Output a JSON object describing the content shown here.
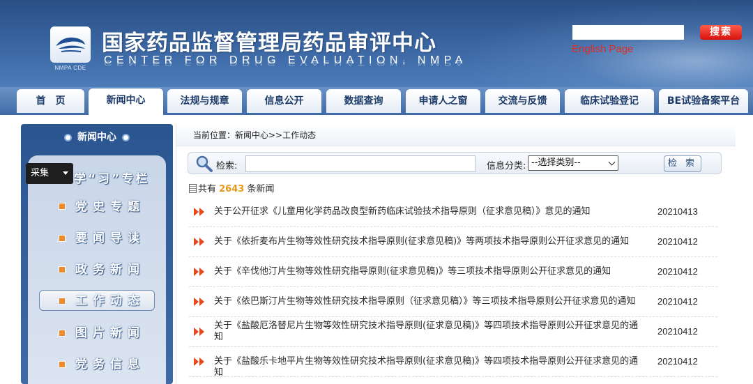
{
  "header": {
    "title_cn": "国家药品监督管理局药品审评中心",
    "title_en": "CENTER FOR DRUG EVALUATION, NMPA",
    "logo_caption": "NMPA CDE",
    "search_button": "搜索",
    "english_link": "English Page"
  },
  "nav": {
    "tabs": [
      {
        "label": "首　页"
      },
      {
        "label": "新闻中心",
        "active": true
      },
      {
        "label": "法规与规章"
      },
      {
        "label": "信息公开"
      },
      {
        "label": "数据查询"
      },
      {
        "label": "申请人之窗"
      },
      {
        "label": "交流与反馈"
      },
      {
        "label": "临床试验登记"
      },
      {
        "label": "BE试验备案平台"
      }
    ]
  },
  "sidebar": {
    "heading": "新闻中心",
    "collect_label": "采集",
    "items": [
      {
        "label": "学“习”专栏"
      },
      {
        "label": "党史专题"
      },
      {
        "label": "要闻导读"
      },
      {
        "label": "政务新闻"
      },
      {
        "label": "工作动态",
        "active": true
      },
      {
        "label": "图片新闻"
      },
      {
        "label": "党务信息"
      }
    ]
  },
  "breadcrumb": {
    "text": "当前位置：新闻中心>>工作动态"
  },
  "search": {
    "label": "检索:",
    "value": "",
    "category_label": "信息分类:",
    "category_selected": "--选择类别--",
    "button": "检 索"
  },
  "count": {
    "prefix": "共有 ",
    "value": "2643",
    "suffix": " 条新闻"
  },
  "colors": {
    "accent": "#e89818",
    "header_blue": "#2a4f86",
    "arrow_red": "#e8281e"
  },
  "news": [
    {
      "title": "关于公开征求《儿童用化学药品改良型新药临床试验技术指导原则（征求意见稿）》意见的通知",
      "date": "20210413"
    },
    {
      "title": "关于《依折麦布片生物等效性研究技术指导原则(征求意见稿)》等两项技术指导原则公开征求意见的通知",
      "date": "20210412"
    },
    {
      "title": "关于《辛伐他汀片生物等效性研究指导原则(征求意见稿)》等三项技术指导原则公开征求意见的通知",
      "date": "20210412"
    },
    {
      "title": "关于《依巴斯汀片生物等效性研究技术指导原则（征求意见稿）》等三项技术指导原则公开征求意见的通知",
      "date": "20210412"
    },
    {
      "title": "关于《盐酸厄洛替尼片生物等效性研究技术指导原则(征求意见稿)》等四项技术指导原则公开征求意见的通知",
      "date": "20210412"
    },
    {
      "title": "关于《盐酸乐卡地平片生物等效性研究技术指导原则(征求意见稿)》等四项技术指导原则公开征求意见的通知",
      "date": "20210412"
    }
  ]
}
